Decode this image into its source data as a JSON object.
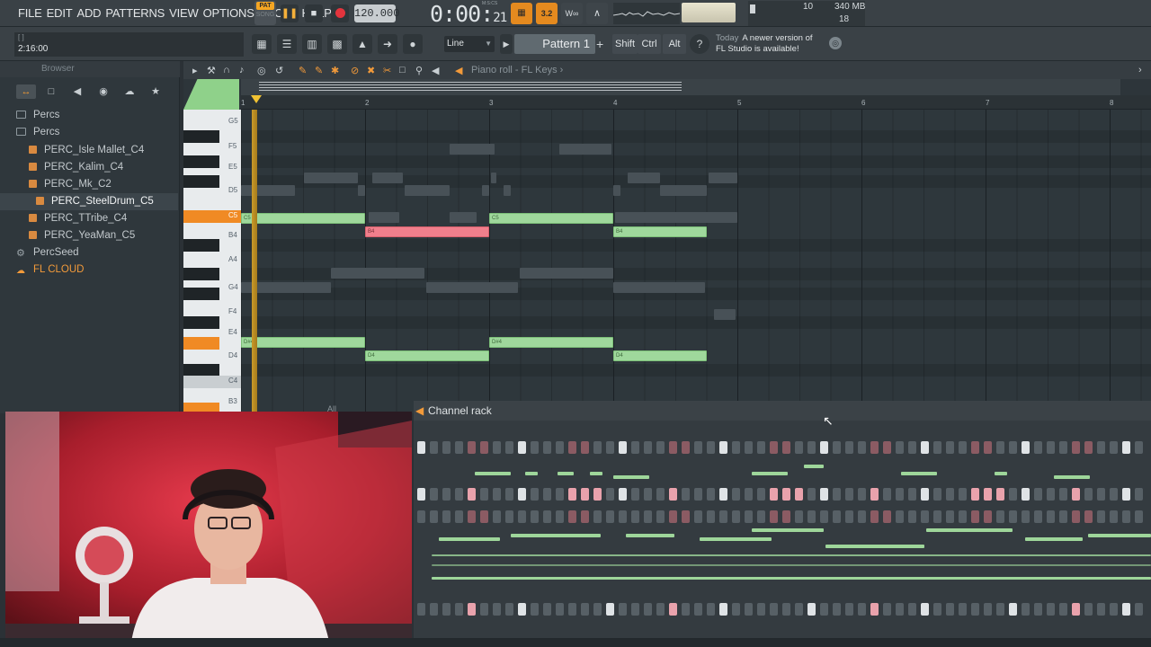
{
  "menu": [
    "FILE",
    "EDIT",
    "ADD",
    "PATTERNS",
    "VIEW",
    "OPTIONS",
    "TOOLS",
    "HELP"
  ],
  "transport": {
    "pat_label": "PAT",
    "song_label": "SONG",
    "tempo": "120.000",
    "time_main": "0:00",
    "time_frac": "21",
    "time_unit": "M:S:CS",
    "cpu_value": "10",
    "mem_value": "340 MB",
    "poly_value": "18"
  },
  "hint": {
    "time": "2:16:00"
  },
  "toolbar2": {
    "snap_mode": "Line",
    "pattern_name": "Pattern 1",
    "shift_label": "Shift",
    "ctrl_label": "Ctrl",
    "alt_label": "Alt",
    "news_today": "Today",
    "news_line1": "A newer version of",
    "news_line2": "FL Studio is available!"
  },
  "browser": {
    "title": "Browser",
    "items": [
      {
        "label": "Percs",
        "type": "folder"
      },
      {
        "label": "Percs",
        "type": "folder"
      },
      {
        "label": "PERC_Isle Mallet_C4",
        "type": "file"
      },
      {
        "label": "PERC_Kalim_C4",
        "type": "file"
      },
      {
        "label": "PERC_Mk_C2",
        "type": "file"
      },
      {
        "label": "PERC_SteelDrum_C5",
        "type": "file",
        "selected": true
      },
      {
        "label": "PERC_TTribe_C4",
        "type": "file"
      },
      {
        "label": "PERC_YeaMan_C5",
        "type": "file"
      },
      {
        "label": "PercSeed",
        "type": "gear"
      },
      {
        "label": "FL CLOUD",
        "type": "cloud"
      }
    ]
  },
  "piano_roll": {
    "title": "Piano roll - FL Keys",
    "bar_numbers": [
      "1",
      "2",
      "3",
      "4",
      "5",
      "6",
      "7",
      "8"
    ],
    "key_labels": [
      "G5",
      "F5",
      "E5",
      "D5",
      "C5",
      "B4",
      "A4",
      "G4",
      "F4",
      "E4",
      "D4",
      "C4",
      "B3"
    ],
    "notes": [
      {
        "label": "C5",
        "pitch": "C5",
        "start": 1,
        "length": 1
      },
      {
        "label": "B4",
        "pitch": "B4",
        "start": 2,
        "length": 1,
        "selected": true
      },
      {
        "label": "C5",
        "pitch": "C5",
        "start": 3,
        "length": 1
      },
      {
        "label": "B4",
        "pitch": "B4",
        "start": 4,
        "length": 0.75
      },
      {
        "label": "D#4",
        "pitch": "D#4",
        "start": 1,
        "length": 1
      },
      {
        "label": "D4",
        "pitch": "D4",
        "start": 2,
        "length": 1
      },
      {
        "label": "D#4",
        "pitch": "D#4",
        "start": 3,
        "length": 1
      },
      {
        "label": "D4",
        "pitch": "D4",
        "start": 4,
        "length": 0.75
      }
    ]
  },
  "channel_rack": {
    "title": "Channel rack",
    "filter": "All"
  },
  "colors": {
    "accent": "#f29a3a",
    "note_green": "#9fd89c",
    "note_red": "#f07f8c",
    "background": "#2b3136"
  }
}
